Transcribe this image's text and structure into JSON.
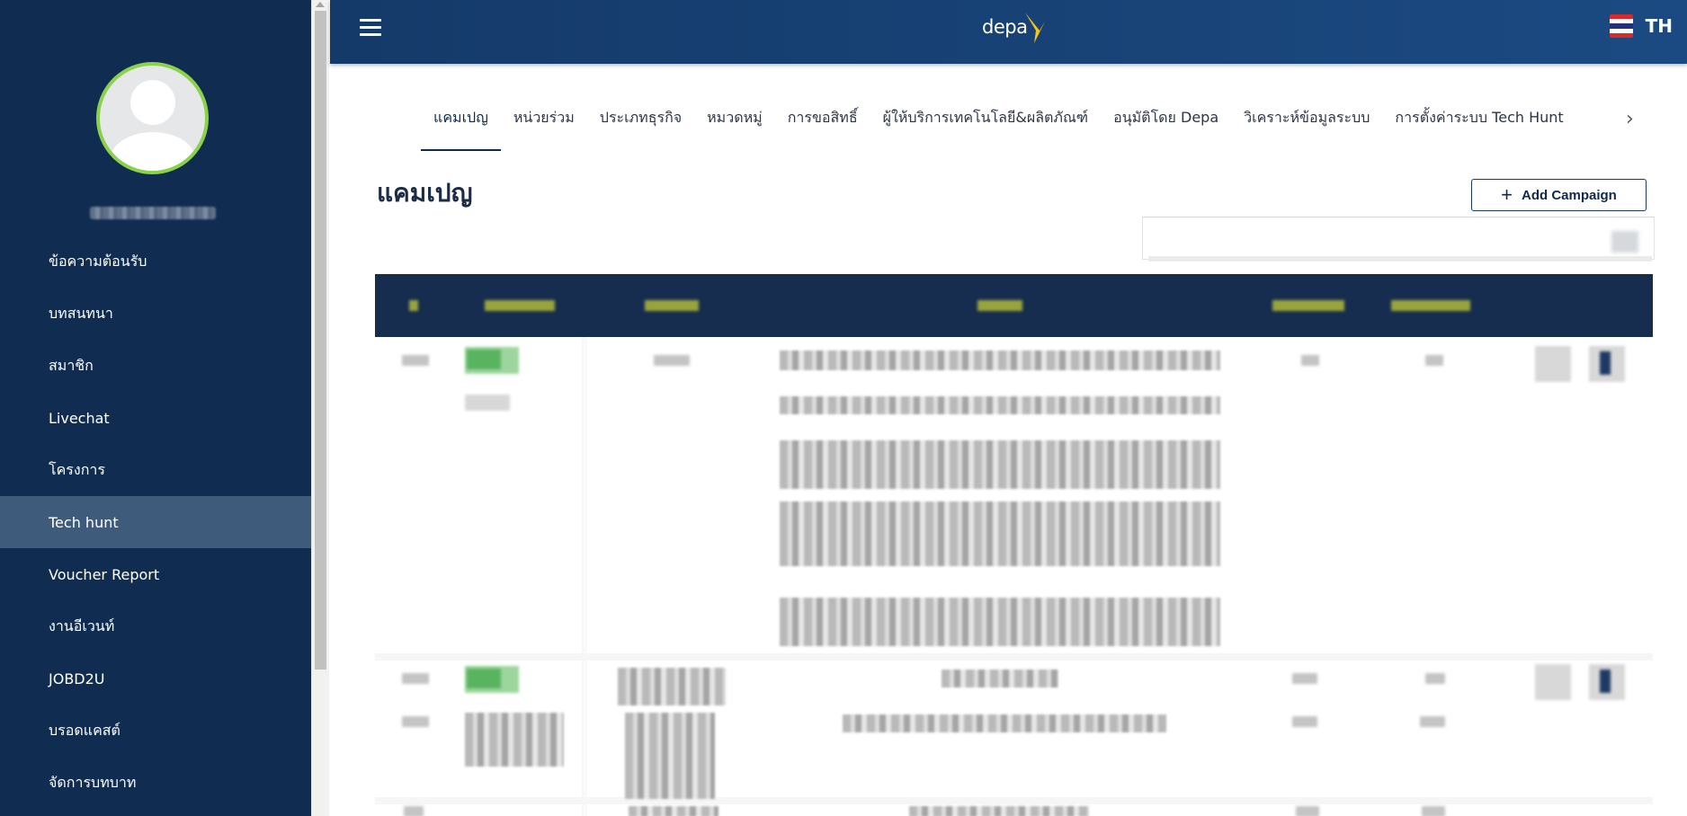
{
  "sidebar": {
    "items": [
      {
        "label": "ข้อความต้อนรับ"
      },
      {
        "label": "บทสนทนา"
      },
      {
        "label": "สมาชิก"
      },
      {
        "label": "Livechat"
      },
      {
        "label": "โครงการ"
      },
      {
        "label": "Tech hunt",
        "active": true
      },
      {
        "label": "Voucher Report"
      },
      {
        "label": "งานอีเวนท์"
      },
      {
        "label": "JOBD2U"
      },
      {
        "label": "บรอดแคสต์"
      },
      {
        "label": "จัดการบทบาท"
      }
    ]
  },
  "header": {
    "logo_text": "depa",
    "lang_code": "TH",
    "colors": {
      "bar": "#143a69",
      "sidebar": "#102d51",
      "logo_accent": "#f5c518",
      "avatar_ring": "#8bd24b"
    }
  },
  "tabs": [
    {
      "label": "แคมเปญ",
      "active": true
    },
    {
      "label": "หน่วยร่วม"
    },
    {
      "label": "ประเภทธุรกิจ"
    },
    {
      "label": "หมวดหมู่"
    },
    {
      "label": "การขอสิทธิ์"
    },
    {
      "label": "ผู้ให้บริการเทคโนโลยี&ผลิตภัณฑ์"
    },
    {
      "label": "อนุมัติโดย Depa"
    },
    {
      "label": "วิเคราะห์ข้อมูลระบบ"
    },
    {
      "label": "การตั้งค่าระบบ Tech Hunt"
    }
  ],
  "page": {
    "title": "แคมเปญ",
    "add_button_label": "Add Campaign"
  }
}
